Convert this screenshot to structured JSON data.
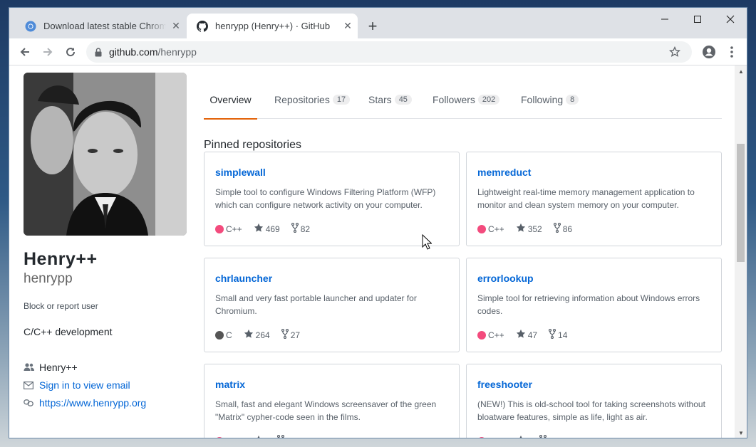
{
  "browser": {
    "tabs": [
      {
        "title": "Download latest stable Chromium",
        "active": false,
        "icon": "chromium-icon"
      },
      {
        "title": "henrypp (Henry++) · GitHub",
        "active": true,
        "icon": "github-icon"
      }
    ],
    "new_tab_label": "+",
    "close_label": "✕",
    "address": {
      "host": "github.com",
      "path": "/henrypp"
    }
  },
  "profile": {
    "fullname": "Henry++",
    "username": "henrypp",
    "block_label": "Block or report user",
    "bio": "C/C++ development",
    "org": "Henry++",
    "email_link": "Sign in to view email",
    "website": "https://www.henrypp.org"
  },
  "nav_tabs": [
    {
      "label": "Overview",
      "count": null,
      "selected": true
    },
    {
      "label": "Repositories",
      "count": "17",
      "selected": false
    },
    {
      "label": "Stars",
      "count": "45",
      "selected": false
    },
    {
      "label": "Followers",
      "count": "202",
      "selected": false
    },
    {
      "label": "Following",
      "count": "8",
      "selected": false
    }
  ],
  "pinned_title": "Pinned repositories",
  "repos": [
    {
      "name": "simplewall",
      "desc": "Simple tool to configure Windows Filtering Platform (WFP) which can configure network activity on your computer.",
      "lang": "C++",
      "lang_color": "#f34b7d",
      "stars": "469",
      "forks": "82"
    },
    {
      "name": "memreduct",
      "desc": "Lightweight real-time memory management application to monitor and clean system memory on your computer.",
      "lang": "C++",
      "lang_color": "#f34b7d",
      "stars": "352",
      "forks": "86"
    },
    {
      "name": "chrlauncher",
      "desc": "Small and very fast portable launcher and updater for Chromium.",
      "lang": "C",
      "lang_color": "#555555",
      "stars": "264",
      "forks": "27"
    },
    {
      "name": "errorlookup",
      "desc": "Simple tool for retrieving information about Windows errors codes.",
      "lang": "C++",
      "lang_color": "#f34b7d",
      "stars": "47",
      "forks": "14"
    },
    {
      "name": "matrix",
      "desc": "Small, fast and elegant Windows screensaver of the green \"Matrix\" cypher-code seen in the films.",
      "lang": "C++",
      "lang_color": "#f34b7d",
      "stars": "",
      "forks": ""
    },
    {
      "name": "freeshooter",
      "desc": "(NEW!) This is old-school tool for taking screenshots without bloatware features, simple as life, light as air.",
      "lang": "C++",
      "lang_color": "#f34b7d",
      "stars": "",
      "forks": ""
    }
  ]
}
